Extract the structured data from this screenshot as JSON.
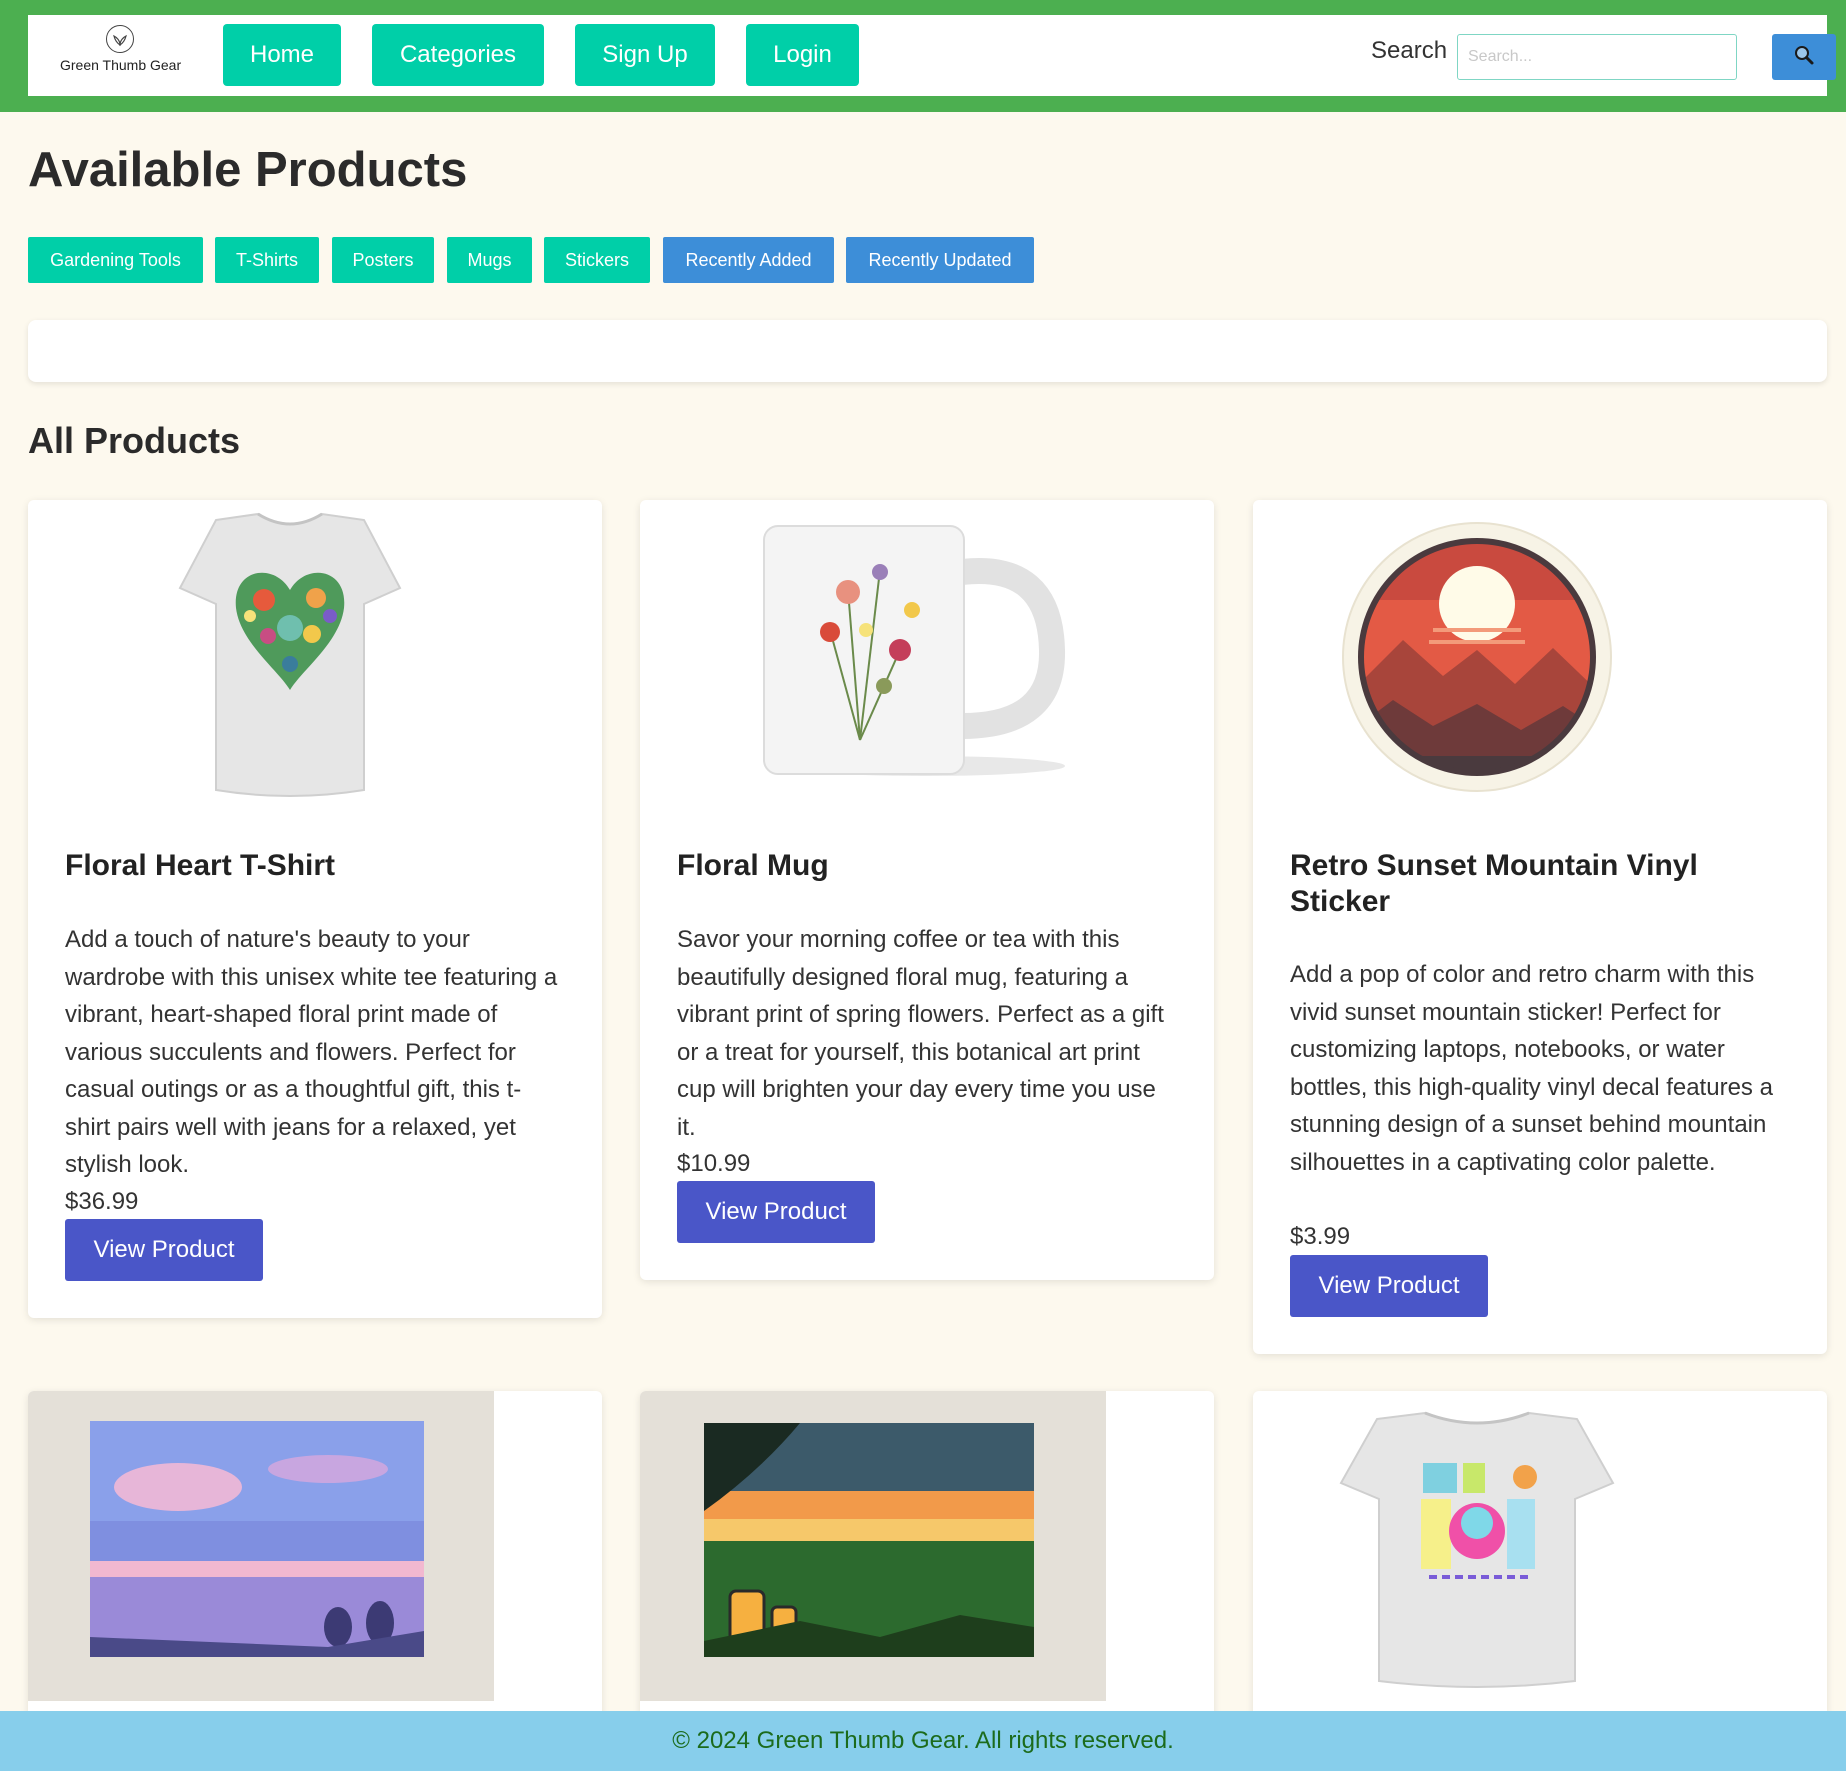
{
  "header": {
    "logo_text": "Green Thumb Gear",
    "nav": [
      {
        "label": "Home"
      },
      {
        "label": "Categories"
      },
      {
        "label": "Sign Up"
      },
      {
        "label": "Login"
      }
    ],
    "search_label": "Search",
    "search_placeholder": "Search...",
    "search_icon": "magnifier-icon"
  },
  "main": {
    "title": "Available Products",
    "categories": [
      {
        "label": "Gardening Tools"
      },
      {
        "label": "T-Shirts"
      },
      {
        "label": "Posters"
      },
      {
        "label": "Mugs"
      },
      {
        "label": "Stickers"
      },
      {
        "label": "Recently Added"
      },
      {
        "label": "Recently Updated"
      }
    ],
    "section_title": "All Products",
    "products": [
      {
        "title": "Floral Heart T-Shirt",
        "description": "Add a touch of nature's beauty to your wardrobe with this unisex white tee featuring a vibrant, heart-shaped floral print made of various succulents and flowers. Perfect for casual outings or as a thoughtful gift, this t-shirt pairs well with jeans for a relaxed, yet stylish look.",
        "price": "$36.99",
        "button": "View Product"
      },
      {
        "title": "Floral Mug",
        "description": "Savor your morning coffee or tea with this beautifully designed floral mug, featuring a vibrant print of spring flowers. Perfect as a gift or a treat for yourself, this botanical art print cup will brighten your day every time you use it.",
        "price": "$10.99",
        "button": "View Product"
      },
      {
        "title": "Retro Sunset Mountain Vinyl Sticker",
        "description": "Add a pop of color and retro charm with this vivid sunset mountain sticker! Perfect for customizing laptops, notebooks, or water bottles, this high-quality vinyl decal features a stunning design of a sunset behind mountain silhouettes in a captivating color palette.",
        "price": "$3.99",
        "button": "View Product"
      }
    ]
  },
  "footer": {
    "text": "© 2024 Green Thumb Gear. All rights reserved."
  },
  "colors": {
    "header_band": "#4caf50",
    "nav_button": "#00cfa8",
    "blue_button": "#3d8ed8",
    "view_button": "#4a56c8",
    "footer": "#87ceeb",
    "page_bg": "#fdf9ee"
  }
}
